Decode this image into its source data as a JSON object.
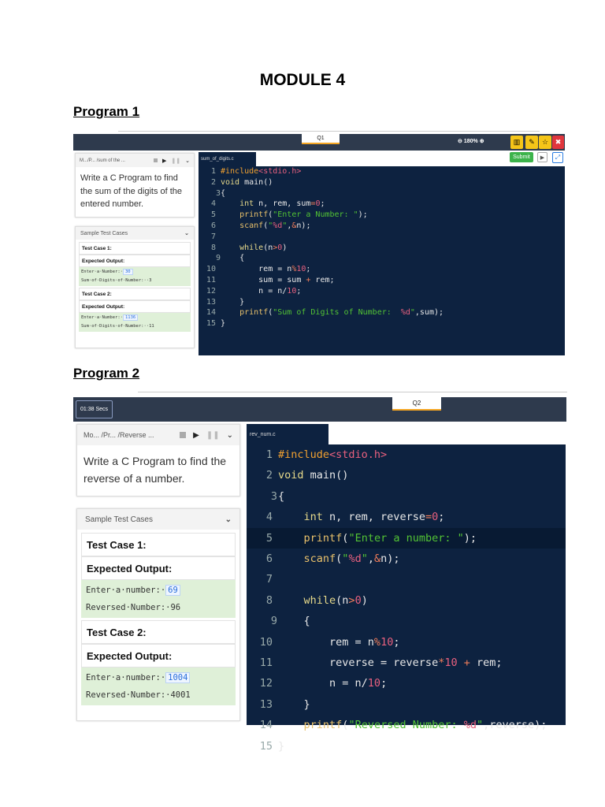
{
  "title": "MODULE 4",
  "programs": [
    {
      "heading": "Program 1",
      "q_label": "Q1",
      "zoom": "180%",
      "submit": "Submit",
      "breadcrumb": "M.../P... /sum of the ...",
      "question": "Write a C Program to find the sum of the digits of the entered number.",
      "sample_header": "Sample Test Cases",
      "tests": [
        {
          "name": "Test Case 1:",
          "expected": "Expected Output:",
          "l1": "Enter·a·Number:·",
          "in": "30",
          "l2": "Sum·of·Digits·of·Number:··3"
        },
        {
          "name": "Test Case 2:",
          "expected": "Expected Output:",
          "l1": "Enter·a·Number:·",
          "in": "1136",
          "l2": "Sum·of·Digits·of·Number:··11"
        }
      ],
      "file": "sum_of_digits.c",
      "code": [
        [
          [
            "inc",
            "#include"
          ],
          [
            "hdr",
            "<stdio.h>"
          ]
        ],
        [
          [
            "kw",
            "void"
          ],
          [
            "pl",
            " main()"
          ]
        ],
        [
          [
            "pl",
            "{"
          ]
        ],
        [
          [
            "pl",
            "    "
          ],
          [
            "kw",
            "int"
          ],
          [
            "pl",
            " n, rem, sum"
          ],
          [
            "op",
            "="
          ],
          [
            "num",
            "0"
          ],
          [
            "pl",
            ";"
          ]
        ],
        [
          [
            "pl",
            "    "
          ],
          [
            "fn",
            "printf"
          ],
          [
            "pl",
            "("
          ],
          [
            "str",
            "\"Enter a Number: \""
          ],
          [
            "pl",
            ");"
          ]
        ],
        [
          [
            "pl",
            "    "
          ],
          [
            "fn",
            "scanf"
          ],
          [
            "pl",
            "("
          ],
          [
            "str",
            "\""
          ],
          [
            "fmt",
            "%d"
          ],
          [
            "str",
            "\""
          ],
          [
            "pl",
            ","
          ],
          [
            "op",
            "&"
          ],
          [
            "pl",
            "n);"
          ]
        ],
        [],
        [
          [
            "pl",
            "    "
          ],
          [
            "kw",
            "while"
          ],
          [
            "pl",
            "(n"
          ],
          [
            "op",
            ">"
          ],
          [
            "num",
            "0"
          ],
          [
            "pl",
            ")"
          ]
        ],
        [
          [
            "pl",
            "    {"
          ]
        ],
        [
          [
            "pl",
            "        rem = n"
          ],
          [
            "op",
            "%"
          ],
          [
            "num",
            "10"
          ],
          [
            "pl",
            ";"
          ]
        ],
        [
          [
            "pl",
            "        sum = sum "
          ],
          [
            "op",
            "+"
          ],
          [
            "pl",
            " rem;"
          ]
        ],
        [
          [
            "pl",
            "        n = n/"
          ],
          [
            "num",
            "10"
          ],
          [
            "pl",
            ";"
          ]
        ],
        [
          [
            "pl",
            "    }"
          ]
        ],
        [
          [
            "pl",
            "    "
          ],
          [
            "fn",
            "printf"
          ],
          [
            "pl",
            "("
          ],
          [
            "str",
            "\"Sum of Digits of Number:  "
          ],
          [
            "fmt",
            "%d"
          ],
          [
            "str",
            "\""
          ],
          [
            "pl",
            ",sum);"
          ]
        ],
        [
          [
            "pl",
            "}"
          ]
        ]
      ]
    },
    {
      "heading": "Program 2",
      "q_label": "Q2",
      "timer": "01:38 Secs",
      "breadcrumb": "Mo... /Pr...  /Reverse ...",
      "question": "Write a C Program to find the reverse of a number.",
      "sample_header": "Sample Test Cases",
      "tests": [
        {
          "name": "Test Case 1:",
          "expected": "Expected Output:",
          "l1": "Enter·a·number:·",
          "in": "69",
          "l2": "Reversed·Number:·96"
        },
        {
          "name": "Test Case 2:",
          "expected": "Expected Output:",
          "l1": "Enter·a·number:·",
          "in": "1004",
          "l2": "Reversed·Number:·4001"
        }
      ],
      "file": "rev_num.c",
      "code": [
        [
          [
            "inc",
            "#include"
          ],
          [
            "hdr",
            "<stdio.h>"
          ]
        ],
        [
          [
            "kw",
            "void"
          ],
          [
            "pl",
            " main()"
          ]
        ],
        [
          [
            "pl",
            "{"
          ]
        ],
        [
          [
            "pl",
            "    "
          ],
          [
            "kw",
            "int"
          ],
          [
            "pl",
            " n, rem, reverse"
          ],
          [
            "op",
            "="
          ],
          [
            "num",
            "0"
          ],
          [
            "pl",
            ";"
          ]
        ],
        [
          [
            "pl",
            "    "
          ],
          [
            "fn",
            "printf"
          ],
          [
            "pl",
            "("
          ],
          [
            "str",
            "\"Enter a number: \""
          ],
          [
            "pl",
            ");"
          ]
        ],
        [
          [
            "pl",
            "    "
          ],
          [
            "fn",
            "scanf"
          ],
          [
            "pl",
            "("
          ],
          [
            "str",
            "\""
          ],
          [
            "fmt",
            "%d"
          ],
          [
            "str",
            "\""
          ],
          [
            "pl",
            ","
          ],
          [
            "op",
            "&"
          ],
          [
            "pl",
            "n);"
          ]
        ],
        [],
        [
          [
            "pl",
            "    "
          ],
          [
            "kw",
            "while"
          ],
          [
            "pl",
            "(n"
          ],
          [
            "op",
            ">"
          ],
          [
            "num",
            "0"
          ],
          [
            "pl",
            ")"
          ]
        ],
        [
          [
            "pl",
            "    {"
          ]
        ],
        [
          [
            "pl",
            "        rem = n"
          ],
          [
            "op",
            "%"
          ],
          [
            "num",
            "10"
          ],
          [
            "pl",
            ";"
          ]
        ],
        [
          [
            "pl",
            "        reverse = reverse"
          ],
          [
            "op",
            "*"
          ],
          [
            "num",
            "10"
          ],
          [
            "pl",
            " "
          ],
          [
            "op",
            "+"
          ],
          [
            "pl",
            " rem;"
          ]
        ],
        [
          [
            "pl",
            "        n = n/"
          ],
          [
            "num",
            "10"
          ],
          [
            "pl",
            ";"
          ]
        ],
        [
          [
            "pl",
            "    }"
          ]
        ],
        [
          [
            "pl",
            "    "
          ],
          [
            "fn",
            "printf"
          ],
          [
            "pl",
            "("
          ],
          [
            "str",
            "\"Reversed Number: "
          ],
          [
            "fmt",
            "%d"
          ],
          [
            "str",
            "\""
          ],
          [
            "pl",
            ",reverse);"
          ]
        ],
        [
          [
            "pl",
            "}"
          ]
        ]
      ]
    }
  ]
}
